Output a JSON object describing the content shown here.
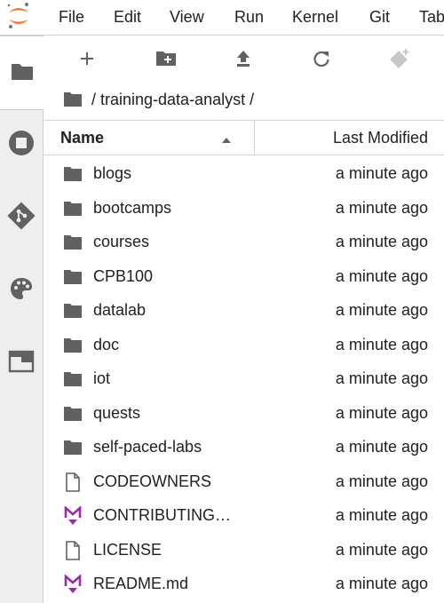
{
  "menubar": {
    "items": [
      "File",
      "Edit",
      "View",
      "Run",
      "Kernel",
      "Git",
      "Tab"
    ]
  },
  "sidebar": {
    "tabs": [
      {
        "icon": "folder-icon",
        "active": true
      },
      {
        "icon": "stop-circle-icon",
        "active": false
      },
      {
        "icon": "git-icon",
        "active": false
      },
      {
        "icon": "palette-icon",
        "active": false
      },
      {
        "icon": "tab-icon",
        "active": false
      }
    ]
  },
  "toolbar": {
    "buttons": [
      "new-launcher-icon",
      "new-folder-icon",
      "upload-icon",
      "refresh-icon",
      "git-clone-icon"
    ]
  },
  "breadcrumb": {
    "path": "/ training-data-analyst /"
  },
  "file_list": {
    "header": {
      "name": "Name",
      "last_modified": "Last Modified"
    },
    "rows": [
      {
        "name": "blogs",
        "type": "folder",
        "modified": "a minute ago"
      },
      {
        "name": "bootcamps",
        "type": "folder",
        "modified": "a minute ago"
      },
      {
        "name": "courses",
        "type": "folder",
        "modified": "a minute ago"
      },
      {
        "name": "CPB100",
        "type": "folder",
        "modified": "a minute ago"
      },
      {
        "name": "datalab",
        "type": "folder",
        "modified": "a minute ago"
      },
      {
        "name": "doc",
        "type": "folder",
        "modified": "a minute ago"
      },
      {
        "name": "iot",
        "type": "folder",
        "modified": "a minute ago"
      },
      {
        "name": "quests",
        "type": "folder",
        "modified": "a minute ago"
      },
      {
        "name": "self-paced-labs",
        "type": "folder",
        "modified": "a minute ago"
      },
      {
        "name": "CODEOWNERS",
        "type": "file",
        "modified": "a minute ago"
      },
      {
        "name": "CONTRIBUTING…",
        "type": "markdown",
        "modified": "a minute ago"
      },
      {
        "name": "LICENSE",
        "type": "file",
        "modified": "a minute ago"
      },
      {
        "name": "README.md",
        "type": "markdown",
        "modified": "a minute ago"
      }
    ]
  },
  "colors": {
    "accent_orange": "#f37726",
    "markdown_purple": "#9c27b0",
    "icon_gray": "#616161"
  }
}
